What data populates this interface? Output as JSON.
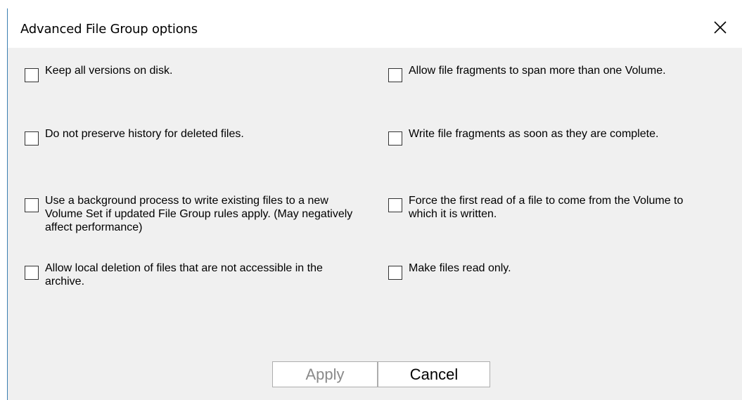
{
  "dialog": {
    "title": "Advanced File Group options",
    "close_icon": "close-icon"
  },
  "options": [
    {
      "label": "Keep all versions on disk.",
      "checked": false
    },
    {
      "label": "Allow file fragments to span more than one Volume.",
      "checked": false
    },
    {
      "label": "Do not preserve history for deleted files.",
      "checked": false
    },
    {
      "label": "Write file fragments as soon as they are complete.",
      "checked": false
    },
    {
      "label": "Use a background process to write existing files to a new Volume Set if updated File Group rules apply. (May negatively affect performance)",
      "checked": false
    },
    {
      "label": "Force the first read of a file to come from the Volume to which it is written.",
      "checked": false
    },
    {
      "label": "Allow local deletion of files that are not accessible in the archive.",
      "checked": false
    },
    {
      "label": "Make files read only.",
      "checked": false
    }
  ],
  "buttons": {
    "apply": "Apply",
    "cancel": "Cancel"
  },
  "colors": {
    "dialog_bg": "#f0f0f0",
    "titlebar_bg": "#ffffff",
    "border_accent": "#3c7fb1",
    "disabled_text": "#8a8a8a"
  }
}
